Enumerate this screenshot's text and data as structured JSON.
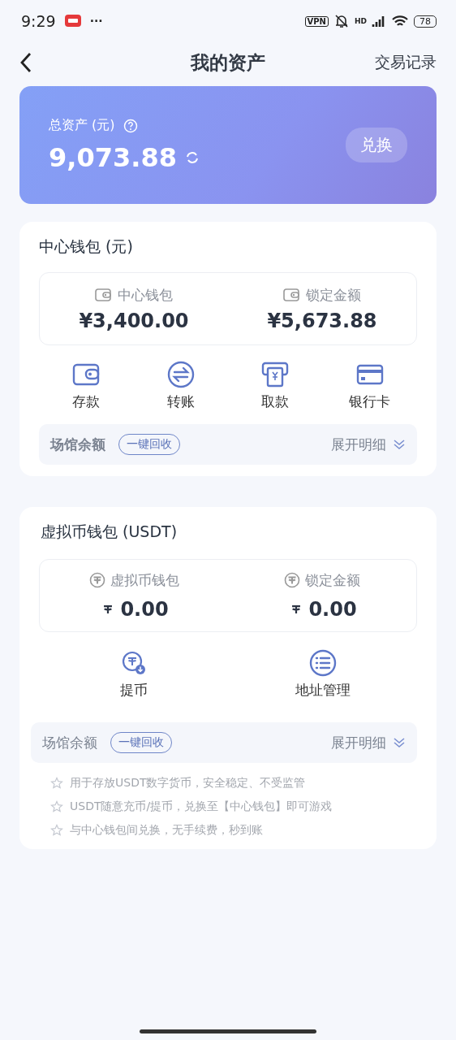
{
  "status_bar": {
    "time": "9:29",
    "more": "···",
    "vpn": "VPN",
    "hd": "HD",
    "battery": "78"
  },
  "header": {
    "title": "我的资产",
    "action": "交易记录"
  },
  "total": {
    "label": "总资产 (元)",
    "amount": "9,073.88",
    "button": "兑换"
  },
  "center_wallet": {
    "title": "中心钱包 (元)",
    "balances": [
      {
        "label": "中心钱包",
        "amount": "¥3,400.00"
      },
      {
        "label": "锁定金额",
        "amount": "¥5,673.88"
      }
    ],
    "actions": [
      {
        "kind": "deposit",
        "label": "存款"
      },
      {
        "kind": "transfer",
        "label": "转账"
      },
      {
        "kind": "withdraw",
        "label": "取款"
      },
      {
        "kind": "card",
        "label": "银行卡"
      }
    ],
    "venue": {
      "label": "场馆余额",
      "button": "一键回收",
      "expand": "展开明细"
    }
  },
  "usdt_wallet": {
    "title": "虚拟币钱包 (USDT)",
    "balances": [
      {
        "label": "虚拟币钱包",
        "amount": "0.00"
      },
      {
        "label": "锁定金额",
        "amount": "0.00"
      }
    ],
    "actions": [
      {
        "kind": "coin_withdraw",
        "label": "提币"
      },
      {
        "kind": "address",
        "label": "地址管理"
      }
    ],
    "venue": {
      "label": "场馆余额",
      "button": "一键回收",
      "expand": "展开明细"
    },
    "notes": [
      "用于存放USDT数字货币，安全稳定、不受监管",
      "USDT随意充币/提币，兑换至【中心钱包】即可游戏",
      "与中心钱包间兑换，无手续费，秒到账"
    ]
  }
}
